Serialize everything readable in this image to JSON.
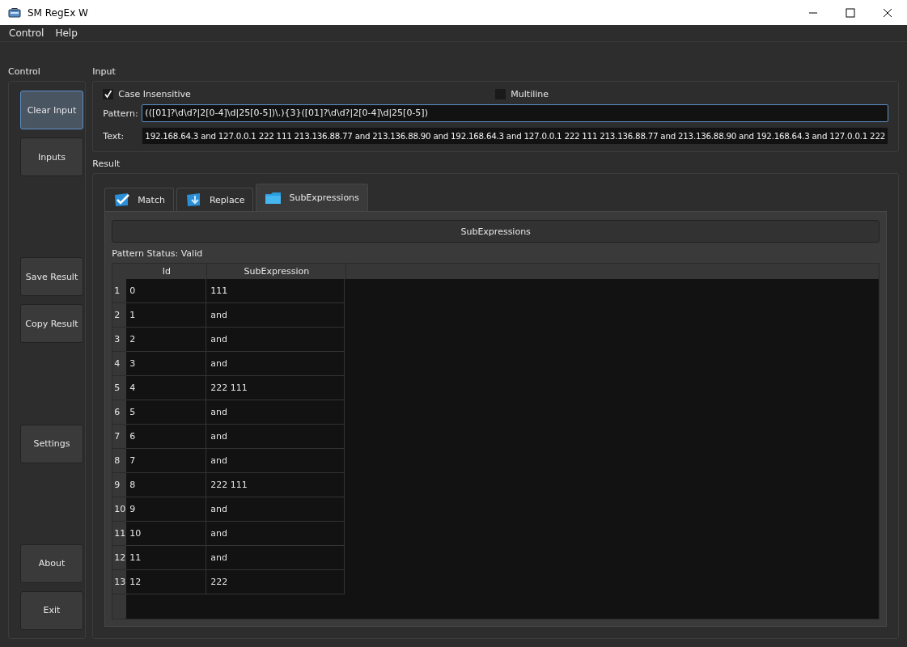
{
  "window": {
    "title": "SM RegEx W"
  },
  "menu": [
    "Control",
    "Help"
  ],
  "control": {
    "title": "Control",
    "groups": [
      [
        {
          "label": "Clear Input",
          "focused": true
        },
        {
          "label": "Inputs",
          "focused": false
        }
      ],
      [
        {
          "label": "Save Result",
          "focused": false
        },
        {
          "label": "Copy Result",
          "focused": false
        }
      ],
      [
        {
          "label": "Settings",
          "focused": false
        }
      ],
      [
        {
          "label": "About",
          "focused": false
        },
        {
          "label": "Exit",
          "focused": false
        }
      ]
    ]
  },
  "input": {
    "title": "Input",
    "options": [
      {
        "label": "Case Insensitive",
        "checked": true
      },
      {
        "label": "Multiline",
        "checked": false
      }
    ],
    "pattern": {
      "label": "Pattern:",
      "value": "(([01]?\\d\\d?|2[0-4]\\d|25[0-5])\\.){3}([01]?\\d\\d?|2[0-4]\\d|25[0-5])"
    },
    "text": {
      "label": "Text:",
      "value": "192.168.64.3 and 127.0.0.1 222 111 213.136.88.77 and 213.136.88.90 and 192.168.64.3 and 127.0.0.1 222 111 213.136.88.77 and 213.136.88.90 and 192.168.64.3 and 127.0.0.1 222"
    }
  },
  "result": {
    "title": "Result",
    "tabs": [
      {
        "label": "Match",
        "kind": "match",
        "selected": false
      },
      {
        "label": "Replace",
        "kind": "replace",
        "selected": false
      },
      {
        "label": "SubExpressions",
        "kind": "subexpressions",
        "selected": true
      }
    ],
    "action_button": "SubExpressions",
    "status": "Pattern Status: Valid",
    "table": {
      "columns": [
        "Id",
        "SubExpression"
      ],
      "rows": [
        {
          "n": "1",
          "id": "0",
          "value": "111"
        },
        {
          "n": "2",
          "id": "1",
          "value": "and"
        },
        {
          "n": "3",
          "id": "2",
          "value": "and"
        },
        {
          "n": "4",
          "id": "3",
          "value": "and"
        },
        {
          "n": "5",
          "id": "4",
          "value": "222 111"
        },
        {
          "n": "6",
          "id": "5",
          "value": "and"
        },
        {
          "n": "7",
          "id": "6",
          "value": "and"
        },
        {
          "n": "8",
          "id": "7",
          "value": "and"
        },
        {
          "n": "9",
          "id": "8",
          "value": "222 111"
        },
        {
          "n": "10",
          "id": "9",
          "value": "and"
        },
        {
          "n": "11",
          "id": "10",
          "value": "and"
        },
        {
          "n": "12",
          "id": "11",
          "value": "and"
        },
        {
          "n": "13",
          "id": "12",
          "value": "222"
        }
      ]
    }
  }
}
